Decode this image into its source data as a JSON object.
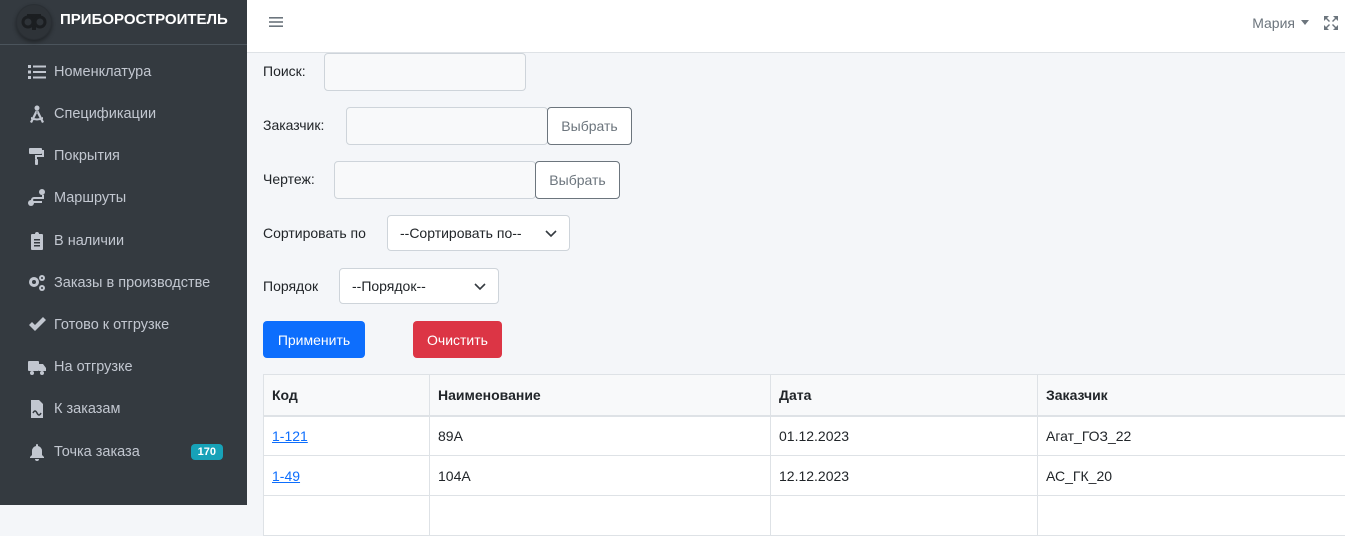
{
  "brand": {
    "name": "ПРИБОРОСТРОИТЕЛЬ",
    "logo_icon": "company-logo"
  },
  "sidebar": {
    "items": [
      {
        "label": "Номенклатура",
        "icon": "list-icon"
      },
      {
        "label": "Спецификации",
        "icon": "drafting-compass-icon"
      },
      {
        "label": "Покрытия",
        "icon": "paint-roller-icon"
      },
      {
        "label": "Маршруты",
        "icon": "route-icon"
      },
      {
        "label": "В наличии",
        "icon": "clipboard-check-icon"
      },
      {
        "label": "Заказы в производстве",
        "icon": "gears-icon"
      },
      {
        "label": "Готово к отгрузке",
        "icon": "check-icon"
      },
      {
        "label": "На отгрузке",
        "icon": "truck-icon"
      },
      {
        "label": "К заказам",
        "icon": "file-invoice-icon"
      },
      {
        "label": "Точка заказа",
        "icon": "bell-icon",
        "badge": "170"
      }
    ]
  },
  "topbar": {
    "user_name": "Мария"
  },
  "filters": {
    "search_label": "Поиск:",
    "search_value": "",
    "customer_label": "Заказчик:",
    "customer_value": "",
    "customer_choose": "Выбрать",
    "drawing_label": "Чертеж:",
    "drawing_value": "",
    "drawing_choose": "Выбрать",
    "sort_label": "Сортировать по",
    "sort_selected": "--Сортировать по--",
    "order_label": "Порядок",
    "order_selected": "--Порядок--",
    "apply_label": "Применить",
    "clear_label": "Очистить"
  },
  "table": {
    "headers": [
      "Код",
      "Наименование",
      "Дата",
      "Заказчик"
    ],
    "rows": [
      [
        "1-121",
        "89А",
        "01.12.2023",
        "Агат_ГОЗ_22"
      ],
      [
        "1-49",
        "104А",
        "12.12.2023",
        "АС_ГК_20"
      ],
      [
        "",
        "",
        "",
        ""
      ]
    ]
  },
  "colors": {
    "sidebar_bg": "#343a40",
    "primary": "#0d6efd",
    "danger": "#dc3545",
    "badge": "#17a2b8"
  }
}
